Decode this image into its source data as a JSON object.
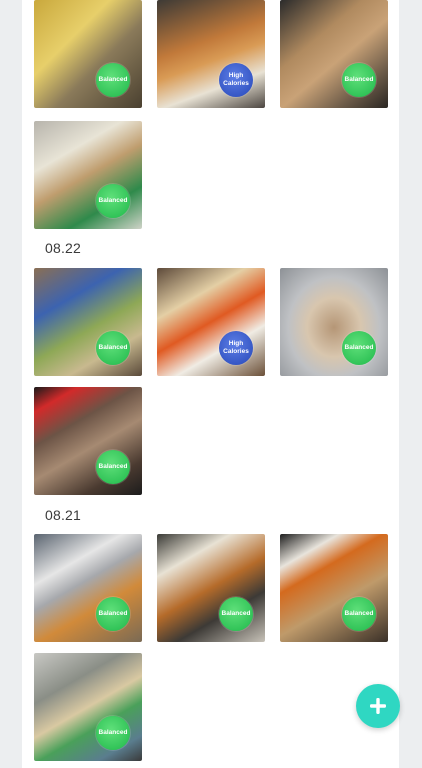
{
  "fab": {
    "icon": "plus-icon"
  },
  "sections": [
    {
      "date": "",
      "meals": [
        {
          "badge": "Balanced",
          "type": "balanced"
        },
        {
          "badge": "High Calories",
          "type": "high"
        },
        {
          "badge": "Balanced",
          "type": "balanced"
        },
        {
          "badge": "Balanced",
          "type": "balanced"
        }
      ]
    },
    {
      "date": "08.22",
      "meals": [
        {
          "badge": "Balanced",
          "type": "balanced"
        },
        {
          "badge": "High Calories",
          "type": "high"
        },
        {
          "badge": "Balanced",
          "type": "balanced"
        },
        {
          "badge": "Balanced",
          "type": "balanced"
        }
      ]
    },
    {
      "date": "08.21",
      "meals": [
        {
          "badge": "Balanced",
          "type": "balanced"
        },
        {
          "badge": "Balanced",
          "type": "balanced"
        },
        {
          "badge": "Balanced",
          "type": "balanced"
        },
        {
          "badge": "Balanced",
          "type": "balanced"
        }
      ]
    }
  ],
  "colors": {
    "balanced": "#22c04c",
    "high_calories": "#3556c8",
    "fab": "#2fd7c2"
  }
}
